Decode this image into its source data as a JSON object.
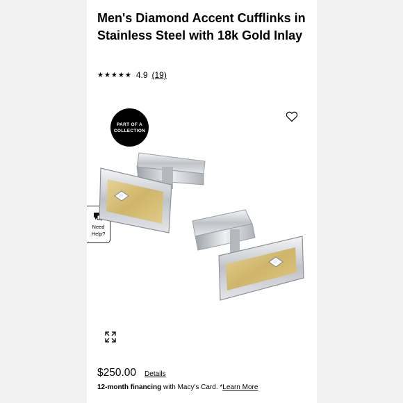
{
  "product": {
    "title": "Men's Diamond Accent Cufflinks in Stainless Steel with 18k Gold Inlay",
    "stars": "★★★★★",
    "rating_value": "4.9",
    "review_count": "(19)"
  },
  "gallery": {
    "badge_line1": "PART OF A",
    "badge_line2": "COLLECTION",
    "help_line1": "Need",
    "help_line2": "Help?"
  },
  "pricing": {
    "price": "$250.00",
    "details_label": "Details",
    "financing_bold": "12-month financing",
    "financing_text": " with Macy's Card. *",
    "learn_more": "Learn More"
  },
  "icons": {
    "heart": "heart-icon",
    "expand": "expand-icon",
    "chat": "chat-icon"
  },
  "colors": {
    "badge_bg": "#000000",
    "page_bg": "#f2f2f2",
    "card_bg": "#ffffff",
    "gold_inlay": "#d9c27a",
    "steel": "#c9ccd0"
  }
}
